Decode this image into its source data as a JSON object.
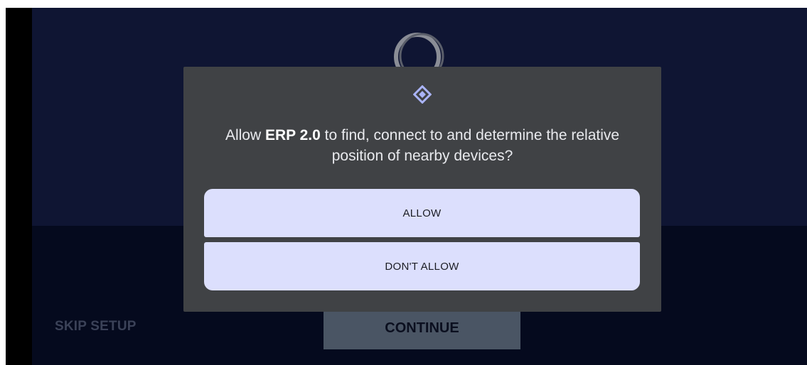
{
  "colors": {
    "screen_background": "#050a1e",
    "app_top_background": "#0f1533",
    "dialog_background": "#404245",
    "button_background": "#dcdffd",
    "accent_icon": "#aab4f8",
    "continue_background": "#4a5564"
  },
  "app": {
    "logo_icon": "ring-logo-icon",
    "skip_label": "SKIP SETUP",
    "continue_label": "CONTINUE"
  },
  "dialog": {
    "icon": "nearby-devices-diamond-icon",
    "message_prefix": "Allow ",
    "app_name": "ERP 2.0",
    "message_suffix": " to find, connect to and determine the relative position of nearby devices?",
    "allow_label": "ALLOW",
    "deny_label": "DON'T ALLOW"
  }
}
